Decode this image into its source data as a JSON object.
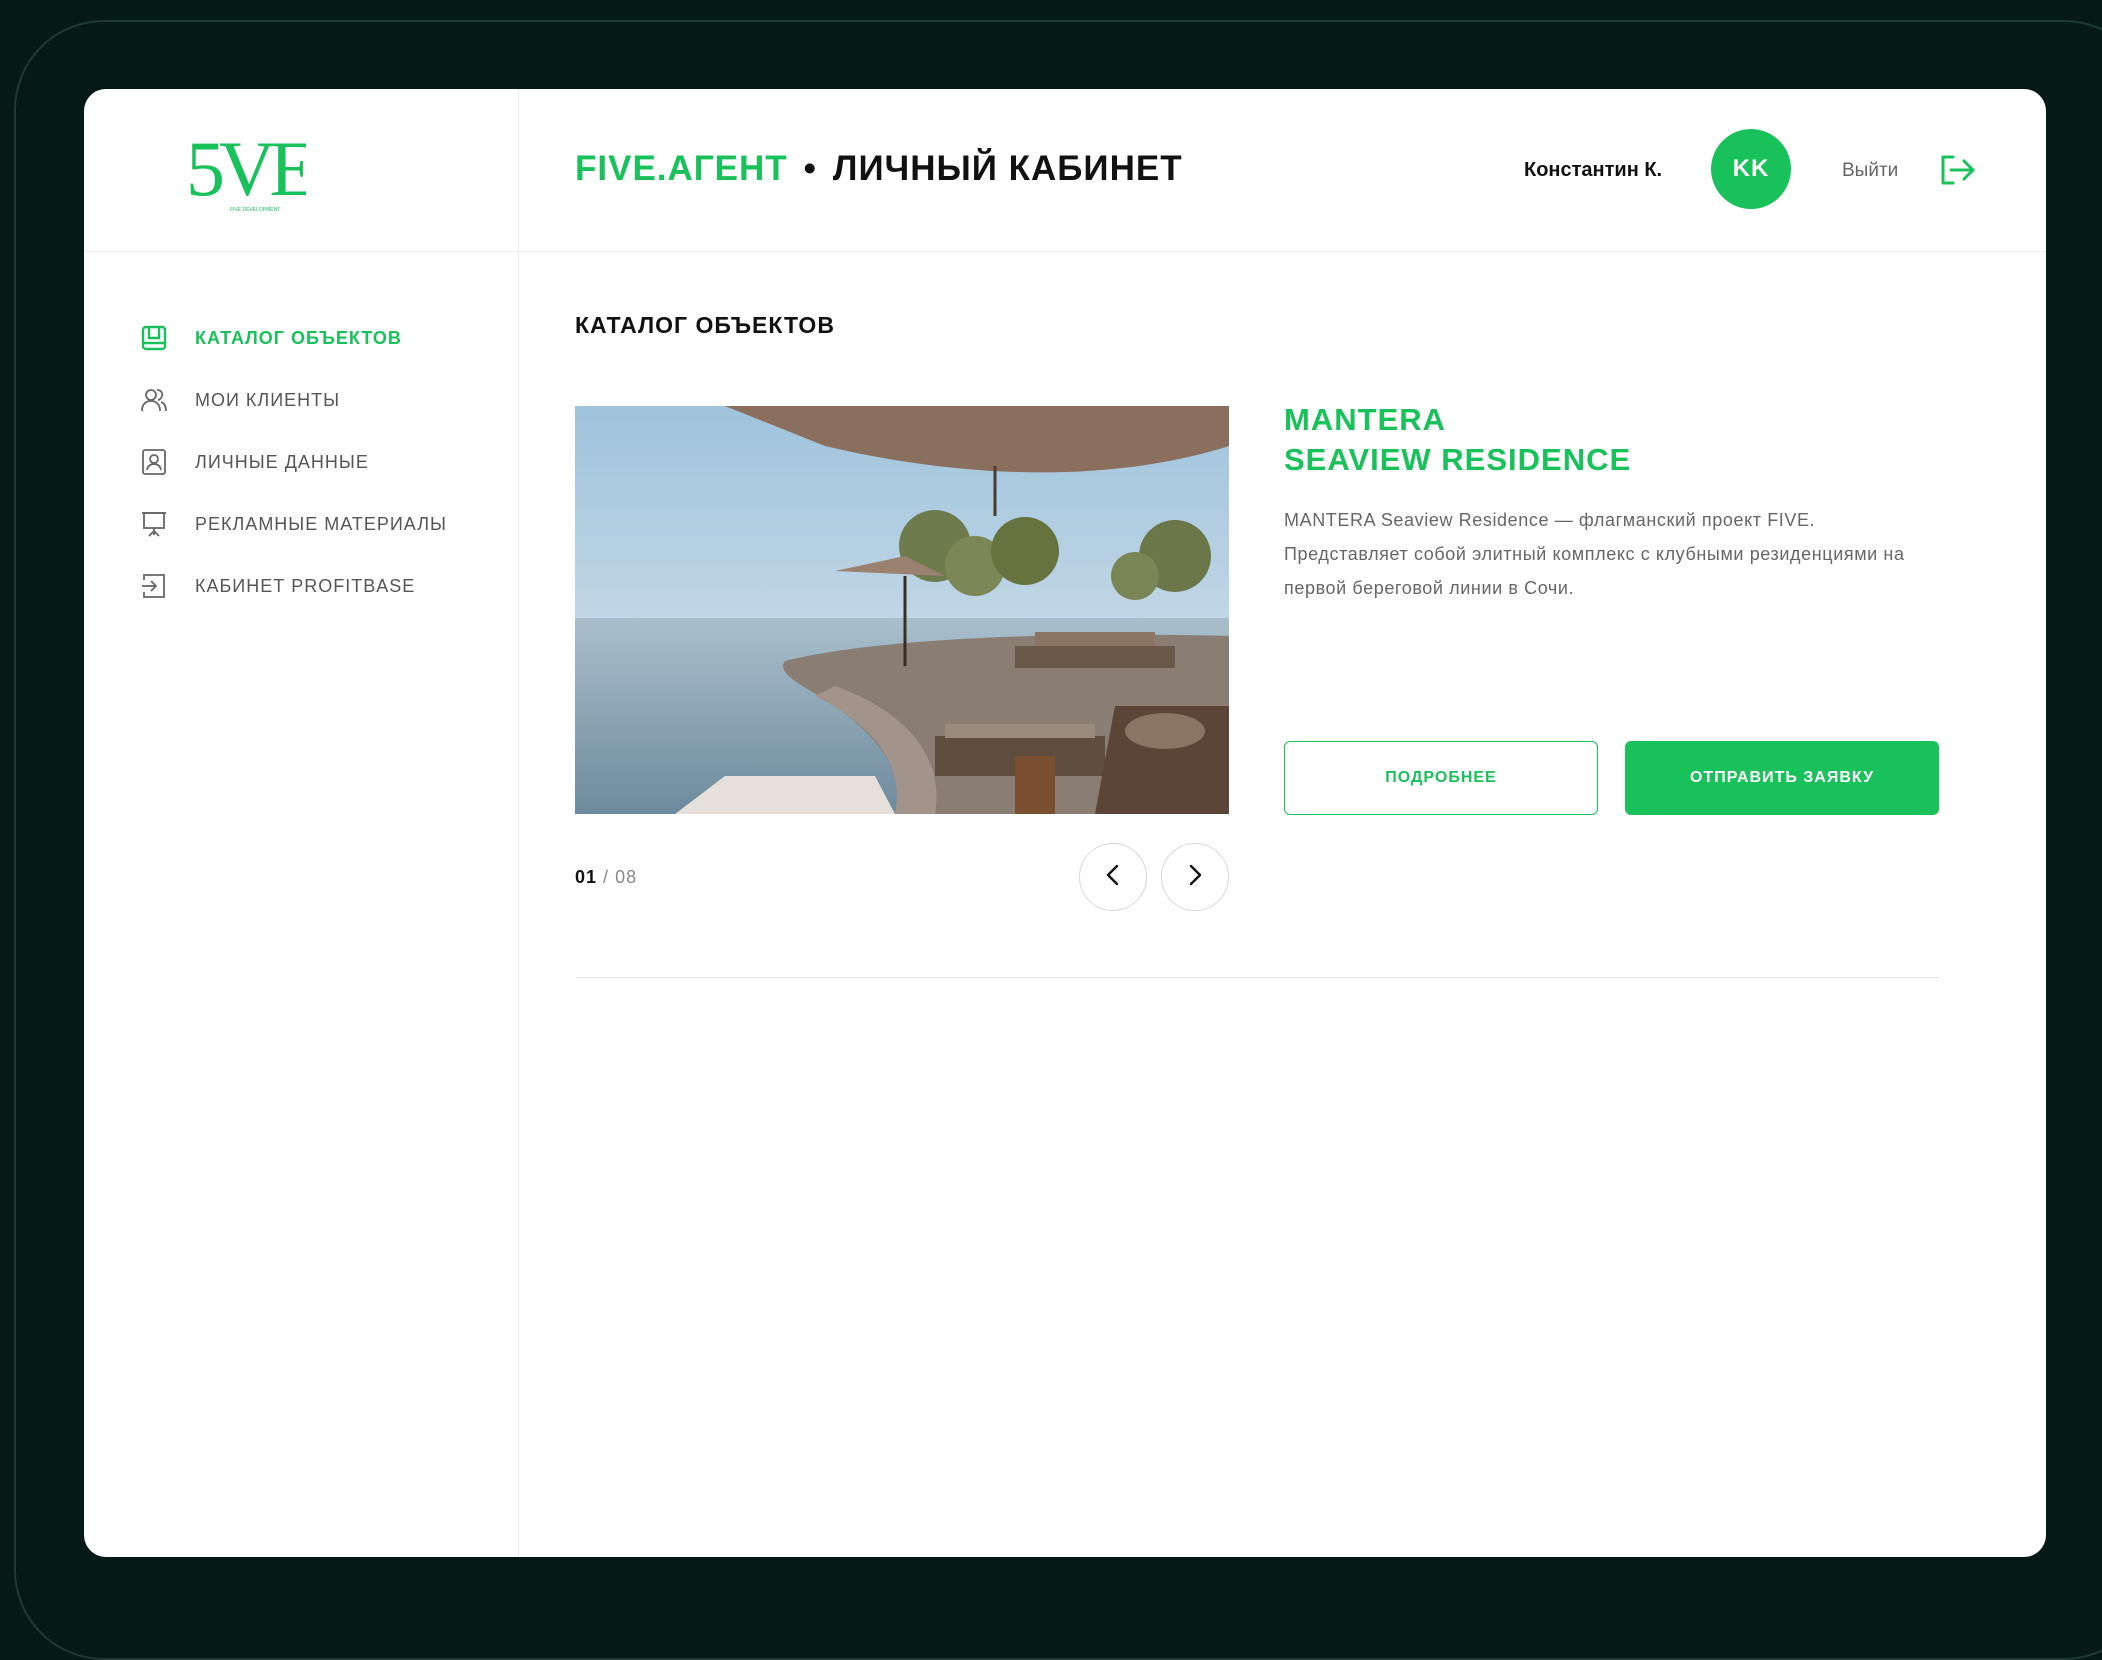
{
  "header": {
    "brand": "FIVE.АГЕНТ",
    "separator": "•",
    "section": "ЛИЧНЫЙ КАБИНЕТ",
    "user_name": "Константин К.",
    "avatar_initials": "KK",
    "logout_label": "Выйти"
  },
  "logo": {
    "mark": "5VE",
    "tagline": "FIVE DEVELOPMENT"
  },
  "sidebar": {
    "items": [
      {
        "label": "КАТАЛОГ ОБЪЕКТОВ",
        "icon": "catalog-icon",
        "active": true
      },
      {
        "label": "МОИ КЛИЕНТЫ",
        "icon": "users-icon",
        "active": false
      },
      {
        "label": "ЛИЧНЫЕ ДАННЫЕ",
        "icon": "profile-card-icon",
        "active": false
      },
      {
        "label": "РЕКЛАМНЫЕ МАТЕРИАЛЫ",
        "icon": "presentation-board-icon",
        "active": false
      },
      {
        "label": "КАБИНЕТ PROFITBASE",
        "icon": "login-icon",
        "active": false
      }
    ]
  },
  "main": {
    "page_title": "КАТАЛОГ ОБЪЕКТОВ",
    "slider": {
      "current": "01",
      "separator": "/",
      "total": "08"
    },
    "project": {
      "title_line1": "MANTERA",
      "title_line2": "SEAVIEW RESIDENCE",
      "description": "MANTERA Seaview Residence — флагманский проект FIVE. Представляет собой элитный комплекс с клубными резиденциями на первой береговой линии в Сочи.",
      "more_label": "ПОДРОБНЕЕ",
      "submit_label": "ОТПРАВИТЬ ЗАЯВКУ"
    }
  },
  "colors": {
    "accent": "#19c15a",
    "background": "#051a16",
    "text": "#111111",
    "muted": "#666666"
  }
}
